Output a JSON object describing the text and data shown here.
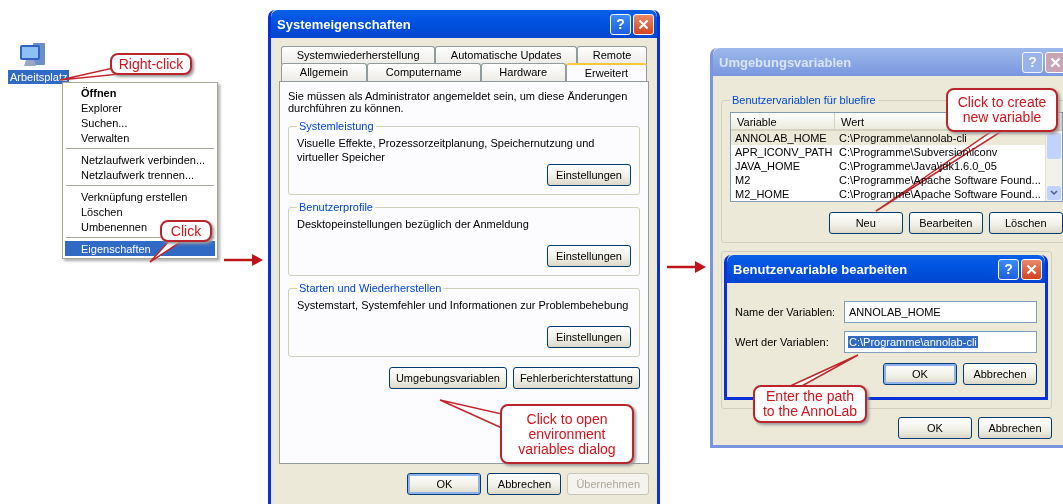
{
  "desktop_icon": {
    "label": "Arbeitsplatz",
    "selected": true
  },
  "context_menu": {
    "items": [
      {
        "kind": "item",
        "label": "Öffnen",
        "default": true,
        "selected": false
      },
      {
        "kind": "item",
        "label": "Explorer",
        "default": false,
        "selected": false
      },
      {
        "kind": "item",
        "label": "Suchen...",
        "default": false,
        "selected": false
      },
      {
        "kind": "item",
        "label": "Verwalten",
        "default": false,
        "selected": false
      },
      {
        "kind": "separator"
      },
      {
        "kind": "item",
        "label": "Netzlaufwerk verbinden...",
        "default": false,
        "selected": false
      },
      {
        "kind": "item",
        "label": "Netzlaufwerk trennen...",
        "default": false,
        "selected": false
      },
      {
        "kind": "separator"
      },
      {
        "kind": "item",
        "label": "Verknüpfung erstellen",
        "default": false,
        "selected": false
      },
      {
        "kind": "item",
        "label": "Löschen",
        "default": false,
        "selected": false
      },
      {
        "kind": "item",
        "label": "Umbenennen",
        "default": false,
        "selected": false
      },
      {
        "kind": "separator"
      },
      {
        "kind": "item",
        "label": "Eigenschaften",
        "default": false,
        "selected": true
      }
    ]
  },
  "system_properties": {
    "title": "Systemeigenschaften",
    "active": true,
    "help_button": "?",
    "tab_rows": [
      [
        {
          "label": "Systemwiederherstellung",
          "selected": false
        },
        {
          "label": "Automatische Updates",
          "selected": false
        },
        {
          "label": "Remote",
          "selected": false
        }
      ],
      [
        {
          "label": "Allgemein",
          "selected": false
        },
        {
          "label": "Computername",
          "selected": false
        },
        {
          "label": "Hardware",
          "selected": false
        },
        {
          "label": "Erweitert",
          "selected": true
        }
      ]
    ],
    "notice": "Sie müssen als Administrator angemeldet sein, um diese Änderungen durchführen zu können.",
    "groups": [
      {
        "title": "Systemleistung",
        "text": "Visuelle Effekte, Prozessorzeitplanung, Speichernutzung und virtueller Speicher",
        "button": "Einstellungen"
      },
      {
        "title": "Benutzerprofile",
        "text": "Desktopeinstellungen bezüglich der Anmeldung",
        "button": "Einstellungen"
      },
      {
        "title": "Starten und Wiederherstellen",
        "text": "Systemstart, Systemfehler und Informationen zur Problembehebung",
        "button": "Einstellungen"
      }
    ],
    "extra_buttons": [
      "Umgebungsvariablen",
      "Fehlerberichterstattung"
    ],
    "footer_buttons": [
      {
        "label": "OK",
        "default": true,
        "disabled": false
      },
      {
        "label": "Abbrechen",
        "default": false,
        "disabled": false
      },
      {
        "label": "Übernehmen",
        "default": false,
        "disabled": true
      }
    ]
  },
  "environment_variables": {
    "title": "Umgebungsvariablen",
    "active": false,
    "help_button": "?",
    "group_title": "Benutzervariablen für bluefire",
    "columns": [
      "Variable",
      "Wert"
    ],
    "rows": [
      {
        "variable": "ANNOLAB_HOME",
        "value": "C:\\Programme\\annolab-cli",
        "selected": true
      },
      {
        "variable": "APR_ICONV_PATH",
        "value": "C:\\Programme\\Subversion\\iconv",
        "selected": false
      },
      {
        "variable": "JAVA_HOME",
        "value": "C:\\Programme\\Java\\jdk1.6.0_05",
        "selected": false
      },
      {
        "variable": "M2",
        "value": "C:\\Programme\\Apache Software Found...",
        "selected": false
      },
      {
        "variable": "M2_HOME",
        "value": "C:\\Programme\\Apache Software Found...",
        "selected": false
      }
    ],
    "buttons": [
      "Neu",
      "Bearbeiten",
      "Löschen"
    ],
    "footer_buttons": [
      {
        "label": "OK",
        "default": false,
        "disabled": false
      },
      {
        "label": "Abbrechen",
        "default": false,
        "disabled": false
      }
    ]
  },
  "edit_variable": {
    "title": "Benutzervariable bearbeiten",
    "active": true,
    "help_button": "?",
    "fields": [
      {
        "label": "Name der Variablen:",
        "value": "ANNOLAB_HOME",
        "selected": false
      },
      {
        "label": "Wert der Variablen:",
        "value": "C:\\Programme\\annolab-cli",
        "selected": true
      }
    ],
    "buttons": [
      {
        "label": "OK",
        "default": true,
        "disabled": false
      },
      {
        "label": "Abbrechen",
        "default": false,
        "disabled": false
      }
    ]
  },
  "callouts": [
    {
      "text": "Right-click"
    },
    {
      "text": "Click"
    },
    {
      "text": "Click to open environment variables dialog"
    },
    {
      "text": "Click to create new variable"
    },
    {
      "text": "Enter the path to the AnnoLab"
    }
  ]
}
